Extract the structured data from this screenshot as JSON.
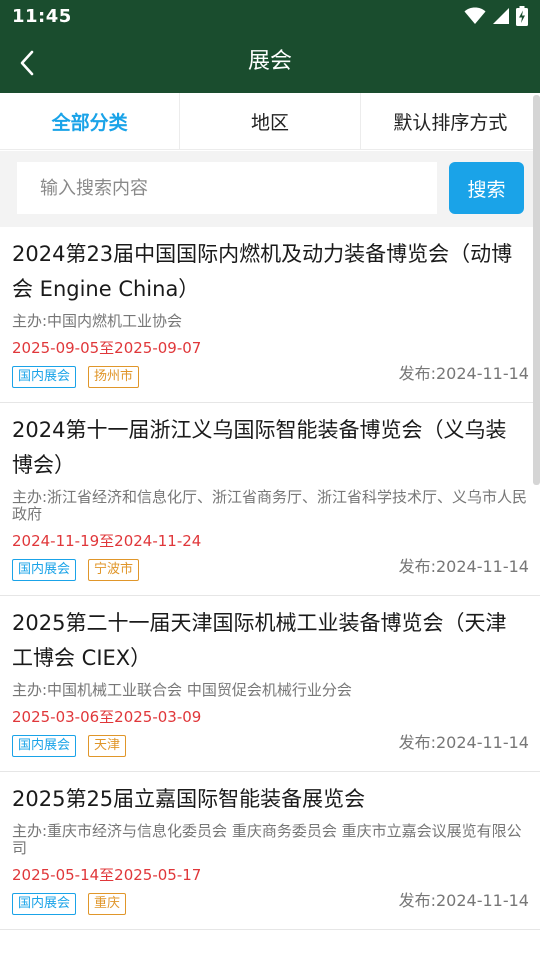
{
  "status_bar": {
    "time": "11:45",
    "icons": [
      "wifi-icon",
      "signal-icon",
      "battery-charging-icon"
    ]
  },
  "header": {
    "title": "展会",
    "back_icon": "chevron-left-icon"
  },
  "filters": [
    {
      "label": "全部分类",
      "active": true
    },
    {
      "label": "地区",
      "active": false
    },
    {
      "label": "默认排序方式",
      "active": false
    }
  ],
  "search": {
    "placeholder": "输入搜索内容",
    "value": "",
    "button_label": "搜索"
  },
  "expos": [
    {
      "title": "2024第23届中国国际内燃机及动力装备博览会（动博会 Engine China）",
      "organizer": "主办:中国内燃机工业协会",
      "date_range": "2025-09-05至2025-09-07",
      "tags": [
        "国内展会",
        "扬州市"
      ],
      "published": "发布:2024-11-14"
    },
    {
      "title": "2024第十一届浙江义乌国际智能装备博览会（义乌装博会）",
      "organizer": "主办:浙江省经济和信息化厅、浙江省商务厅、浙江省科学技术厅、义乌市人民政府",
      "date_range": "2024-11-19至2024-11-24",
      "tags": [
        "国内展会",
        "宁波市"
      ],
      "published": "发布:2024-11-14"
    },
    {
      "title": "2025第二十一届天津国际机械工业装备博览会（天津工博会 CIEX）",
      "organizer": "主办:中国机械工业联合会 中国贸促会机械行业分会",
      "date_range": "2025-03-06至2025-03-09",
      "tags": [
        "国内展会",
        "天津"
      ],
      "published": "发布:2024-11-14"
    },
    {
      "title": "2025第25届立嘉国际智能装备展览会",
      "organizer": "主办:重庆市经济与信息化委员会 重庆商务委员会 重庆市立嘉会议展览有限公司",
      "date_range": "2025-05-14至2025-05-17",
      "tags": [
        "国内展会",
        "重庆"
      ],
      "published": "发布:2024-11-14"
    }
  ],
  "colors": {
    "app_bar": "#1a4d2e",
    "accent": "#1aa3e8",
    "date": "#e0373a",
    "region_tag": "#e0962a"
  }
}
